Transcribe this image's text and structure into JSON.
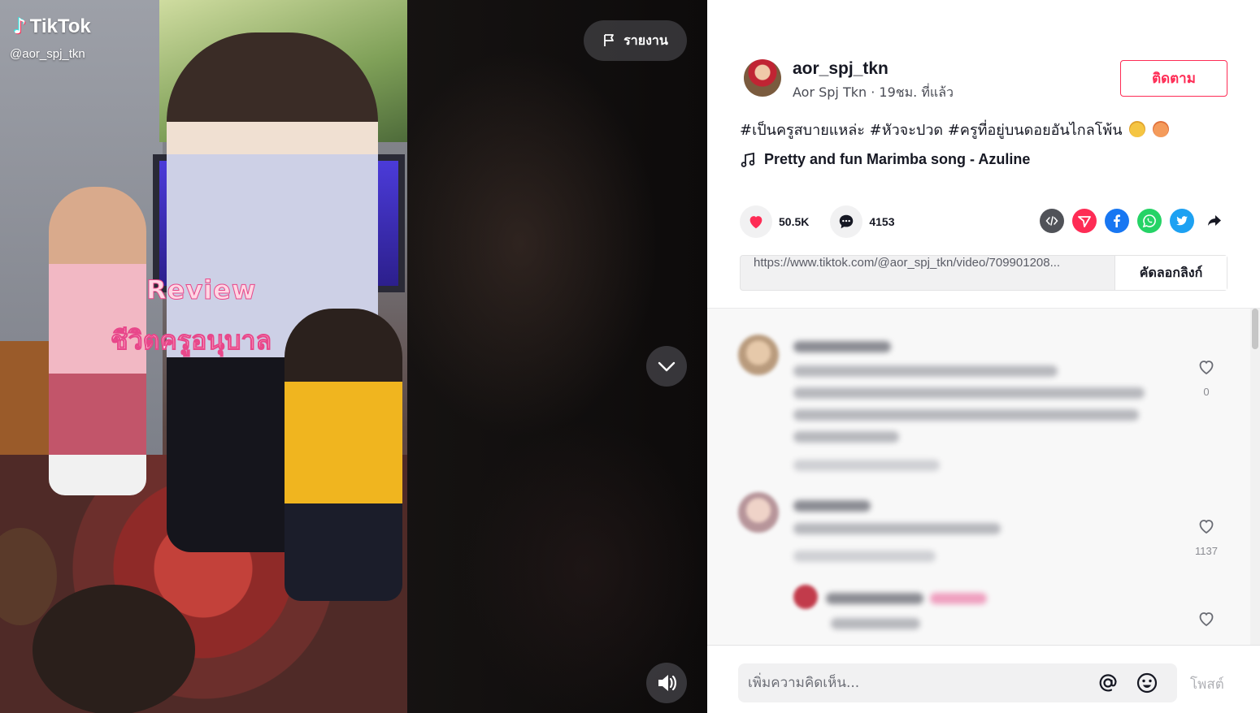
{
  "video": {
    "logo_text": "TikTok",
    "watermark_handle": "@aor_spj_tkn",
    "overlay_line1": "Review",
    "overlay_line2": "ชีวิตครูอนุบาล",
    "report_label": "รายงาน"
  },
  "post": {
    "username": "aor_spj_tkn",
    "display_name": "Aor Spj Tkn",
    "time_ago": "19ชม. ที่แล้ว",
    "subline": "Aor Spj Tkn · 19ชม. ที่แล้ว",
    "follow_label": "ติดตาม",
    "caption": "#เป็นครูสบายแหล่ะ #หัวจะปวด #ครูที่อยู่บนดอยอันไกลโพ้น",
    "music": "Pretty and fun Marimba song - Azuline",
    "likes": "50.5K",
    "comments": "4153",
    "share_icons": [
      "embed-icon",
      "send-icon",
      "facebook-icon",
      "whatsapp-icon",
      "twitter-icon",
      "share-arrow-icon"
    ],
    "link": "https://www.tiktok.com/@aor_spj_tkn/video/709901208...",
    "copy_label": "คัดลอกลิงก์"
  },
  "comments": {
    "items": [
      {
        "likes": "0"
      },
      {
        "likes": "1137"
      },
      {
        "likes": ""
      }
    ]
  },
  "footer": {
    "placeholder": "เพิ่มความคิดเห็น...",
    "post_label": "โพสต์"
  },
  "colors": {
    "brand_red": "#fe2c55",
    "text_dark": "#161823",
    "facebook": "#1877f2",
    "whatsapp": "#25d366",
    "twitter": "#1da1f2"
  }
}
